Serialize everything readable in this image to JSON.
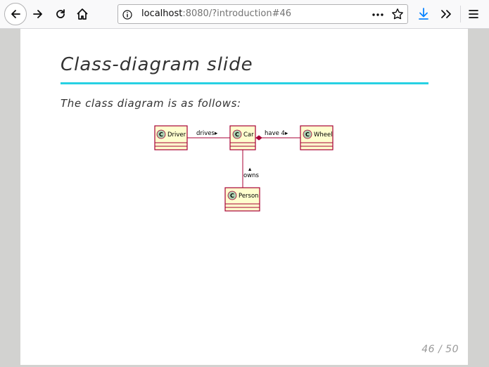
{
  "browser": {
    "url_host": "localhost",
    "url_rest": ":8080/?introduction#46"
  },
  "slide": {
    "title": "Class-diagram slide",
    "text": "The class diagram is as follows:",
    "page_number": "46 / 50",
    "diagram": {
      "classes": [
        "Driver",
        "Car",
        "Wheel",
        "Person"
      ],
      "relations": [
        {
          "from": "Driver",
          "to": "Car",
          "label": "drives▸"
        },
        {
          "from": "Car",
          "to": "Wheel",
          "label": "have 4▸"
        },
        {
          "from": "Car",
          "to": "Person",
          "label": "owns"
        }
      ],
      "owns_arrow": "▴",
      "class_icon": "C"
    }
  },
  "colors": {
    "accent_rule": "#27d1e3",
    "uml_fill": "#fefece",
    "uml_border": "#a80036",
    "uml_icon": "#add1b2"
  }
}
